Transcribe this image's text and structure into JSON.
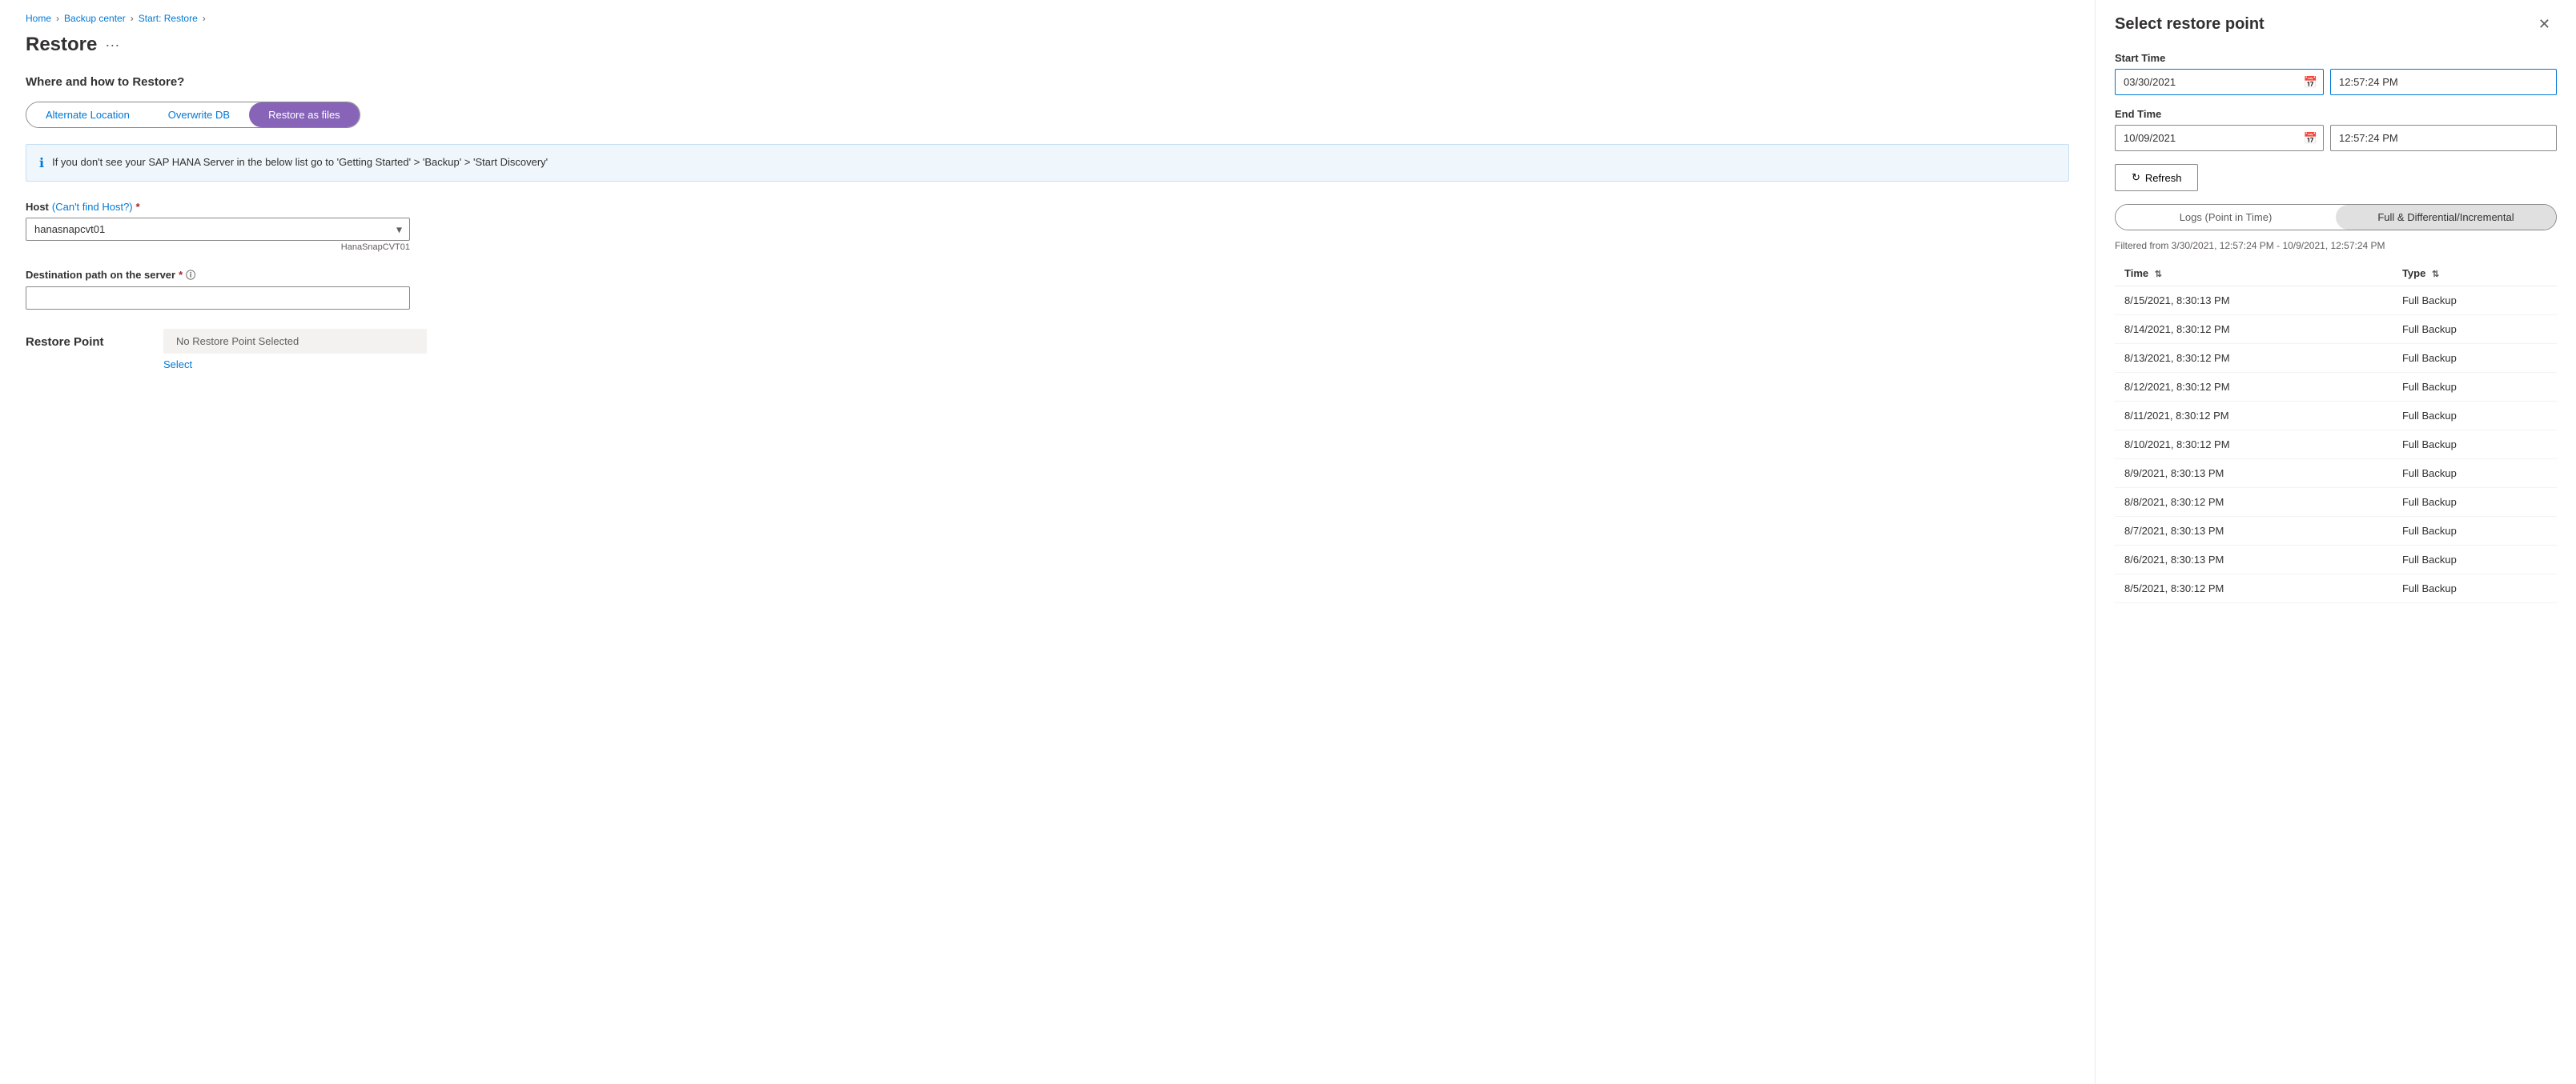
{
  "breadcrumb": {
    "home": "Home",
    "backup_center": "Backup center",
    "start_restore": "Start: Restore",
    "current": "Restore"
  },
  "page": {
    "title": "Restore",
    "dots": "···"
  },
  "section": {
    "where_how": "Where and how to Restore?"
  },
  "tabs": {
    "alternate_location": "Alternate Location",
    "overwrite_db": "Overwrite DB",
    "restore_as_files": "Restore as files"
  },
  "info_banner": {
    "text": "If you don't see your SAP HANA Server in the below list go to 'Getting Started' > 'Backup' > 'Start Discovery'"
  },
  "host_field": {
    "label": "Host",
    "cant_find": "(Can't find Host?)",
    "value": "hanasnapcvt01",
    "hint": "HanaSnapCVT01"
  },
  "destination_field": {
    "label": "Destination path on the server",
    "placeholder": ""
  },
  "restore_point": {
    "label": "Restore Point",
    "no_selection": "No Restore Point Selected",
    "select_link": "Select"
  },
  "right_panel": {
    "title": "Select restore point",
    "close": "✕",
    "start_time_label": "Start Time",
    "start_date": "03/30/2021",
    "start_time": "12:57:24 PM",
    "end_time_label": "End Time",
    "end_date": "10/09/2021",
    "end_time": "12:57:24 PM",
    "refresh_button": "Refresh",
    "toggle_logs": "Logs (Point in Time)",
    "toggle_full": "Full & Differential/Incremental",
    "filter_info": "Filtered from 3/30/2021, 12:57:24 PM - 10/9/2021, 12:57:24 PM",
    "table": {
      "col_time": "Time",
      "col_type": "Type",
      "rows": [
        {
          "time": "8/15/2021, 8:30:13 PM",
          "type": "Full Backup"
        },
        {
          "time": "8/14/2021, 8:30:12 PM",
          "type": "Full Backup"
        },
        {
          "time": "8/13/2021, 8:30:12 PM",
          "type": "Full Backup"
        },
        {
          "time": "8/12/2021, 8:30:12 PM",
          "type": "Full Backup"
        },
        {
          "time": "8/11/2021, 8:30:12 PM",
          "type": "Full Backup"
        },
        {
          "time": "8/10/2021, 8:30:12 PM",
          "type": "Full Backup"
        },
        {
          "time": "8/9/2021, 8:30:13 PM",
          "type": "Full Backup"
        },
        {
          "time": "8/8/2021, 8:30:12 PM",
          "type": "Full Backup"
        },
        {
          "time": "8/7/2021, 8:30:13 PM",
          "type": "Full Backup"
        },
        {
          "time": "8/6/2021, 8:30:13 PM",
          "type": "Full Backup"
        },
        {
          "time": "8/5/2021, 8:30:12 PM",
          "type": "Full Backup"
        }
      ]
    }
  },
  "colors": {
    "active_tab_bg": "#8764b8",
    "link": "#0078d4",
    "required": "#a4262c"
  }
}
